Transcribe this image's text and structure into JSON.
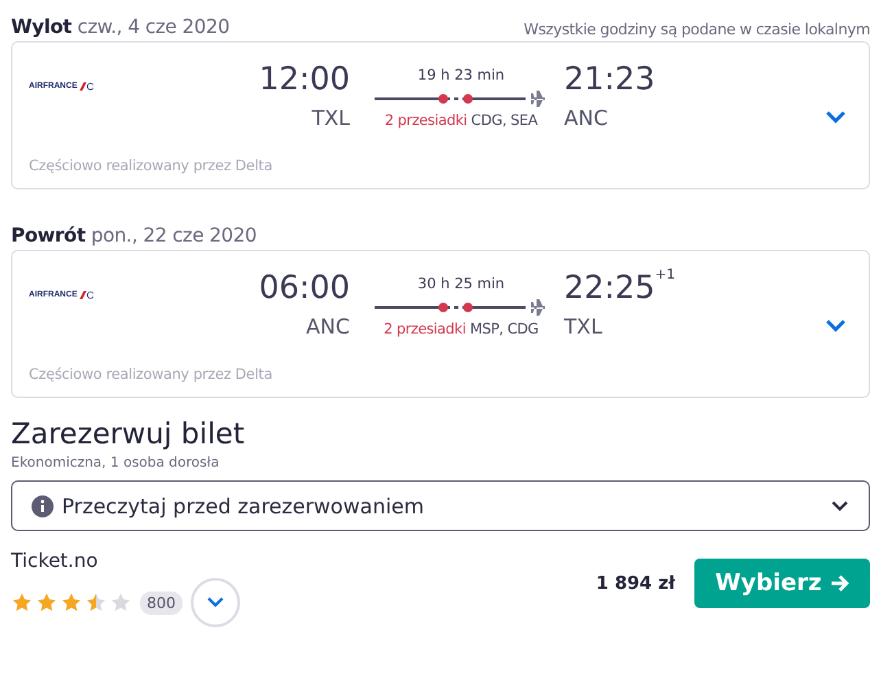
{
  "note": "Wszystkie godziny są podane w czasie lokalnym",
  "legs": [
    {
      "label": "Wylot",
      "date": "czw., 4 cze 2020",
      "airline": "AIRFRANCE",
      "dep_time": "12:00",
      "dep_airport": "TXL",
      "duration": "19 h 23 min",
      "stops": "2 przesiadki",
      "stop_airports": "CDG, SEA",
      "arr_time": "21:23",
      "arr_airport": "ANC",
      "operated_by": "Częściowo realizowany przez Delta"
    },
    {
      "label": "Powrót",
      "date": "pon., 22 cze 2020",
      "airline": "AIRFRANCE",
      "dep_time": "06:00",
      "dep_airport": "ANC",
      "duration": "30 h 25 min",
      "stops": "2 przesiadki",
      "stop_airports": "MSP, CDG",
      "arr_time": "22:25",
      "arr_day_offset": "+1",
      "arr_airport": "TXL",
      "operated_by": "Częściowo realizowany przez Delta"
    }
  ],
  "booking": {
    "title": "Zarezerwuj bilet",
    "subtitle": "Ekonomiczna, 1 osoba dorosła",
    "info": "Przeczytaj przed zarezerwowaniem",
    "provider": "Ticket.no",
    "stars": 3.5,
    "reviews": "800",
    "price": "1 894 zł",
    "button": "Wybierz"
  }
}
